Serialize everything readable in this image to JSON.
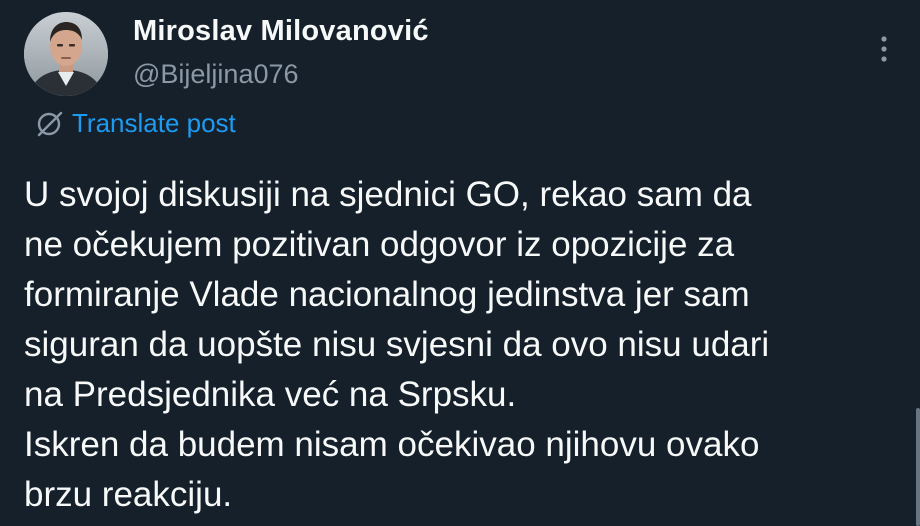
{
  "post": {
    "author": {
      "display_name": "Miroslav Milovanović",
      "handle": "@Bijeljina076",
      "avatar_icon": "user-avatar-photo"
    },
    "more_icon": "more-vertical-icon",
    "translate": {
      "icon": "globe-slash-icon",
      "label": "Translate post"
    },
    "text_lines": [
      "U svojoj diskusiji na sjednici GO, rekao sam da",
      "ne očekujem pozitivan odgovor iz opozicije za",
      "formiranje Vlade nacionalnog jedinstva jer sam",
      "siguran da uopšte nisu svjesni da ovo nisu udari",
      "na Predsjednika već na Srpsku.",
      "Iskren da budem nisam očekivao njihovu ovako",
      "brzu reakciju."
    ]
  },
  "colors": {
    "background": "#15202b",
    "text_primary": "#f7f9f9",
    "text_secondary": "#8b98a5",
    "accent": "#1d9bf0"
  }
}
